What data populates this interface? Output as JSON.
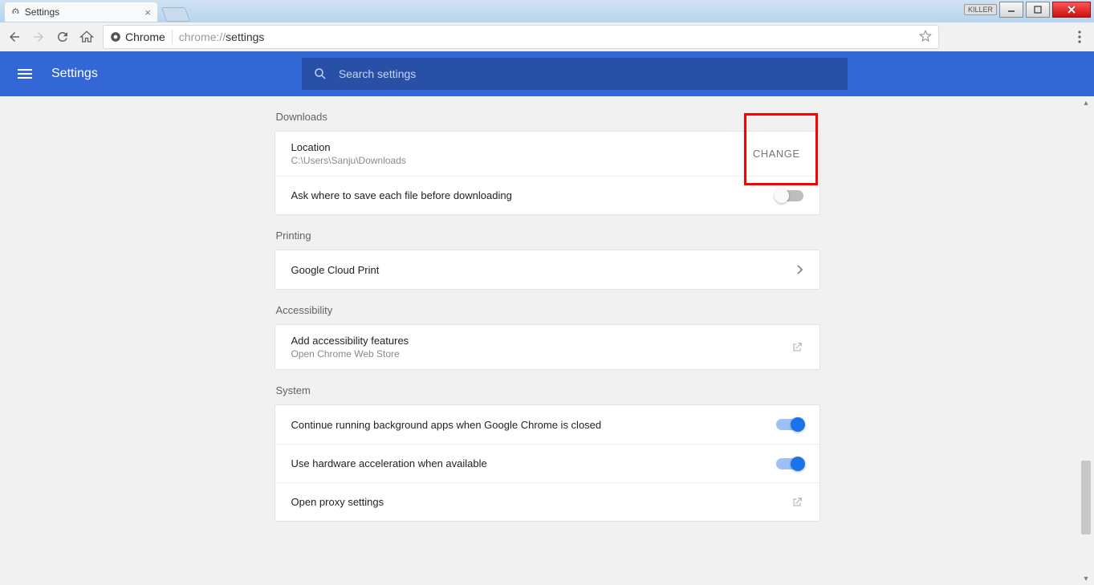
{
  "os": {
    "tag": "KILLER"
  },
  "tab": {
    "title": "Settings"
  },
  "address": {
    "source_label": "Chrome",
    "url_prefix": "chrome://",
    "url_path": "settings"
  },
  "header": {
    "title": "Settings",
    "search_placeholder": "Search settings"
  },
  "sections": {
    "downloads": {
      "title": "Downloads",
      "location_label": "Location",
      "location_value": "C:\\Users\\Sanju\\Downloads",
      "change_label": "CHANGE",
      "ask_label": "Ask where to save each file before downloading",
      "ask_toggle": false
    },
    "printing": {
      "title": "Printing",
      "gcp_label": "Google Cloud Print"
    },
    "accessibility": {
      "title": "Accessibility",
      "add_label": "Add accessibility features",
      "add_sub": "Open Chrome Web Store"
    },
    "system": {
      "title": "System",
      "bg_label": "Continue running background apps when Google Chrome is closed",
      "bg_toggle": true,
      "hw_label": "Use hardware acceleration when available",
      "hw_toggle": true,
      "proxy_label": "Open proxy settings"
    }
  }
}
